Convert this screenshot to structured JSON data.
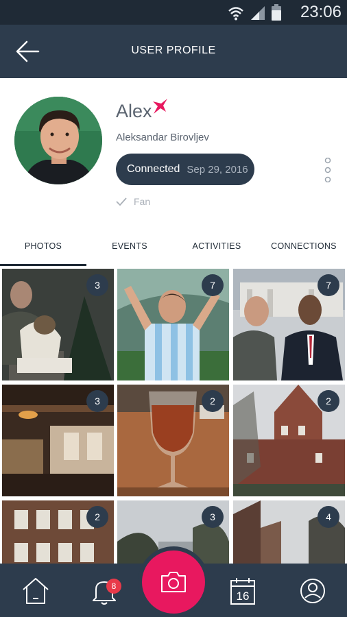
{
  "status_bar": {
    "time": "23:06",
    "icons": [
      "wifi-icon",
      "signal-icon",
      "battery-icon"
    ]
  },
  "header": {
    "title": "USER PROFILE",
    "back_icon": "arrow-left-icon"
  },
  "profile": {
    "name": "Alex",
    "full_name": "Aleksandar Birovljev",
    "connection_status": "Connected",
    "connection_date": "Sep 29, 2016",
    "relationship": "Fan",
    "accent_color": "#e8185f"
  },
  "tabs": [
    {
      "label": "PHOTOS",
      "active": true
    },
    {
      "label": "EVENTS",
      "active": false
    },
    {
      "label": "ACTIVITIES",
      "active": false
    },
    {
      "label": "CONNECTIONS",
      "active": false
    }
  ],
  "photos": [
    {
      "count": "3"
    },
    {
      "count": "7"
    },
    {
      "count": "7"
    },
    {
      "count": "3"
    },
    {
      "count": "2"
    },
    {
      "count": "2"
    },
    {
      "count": "2"
    },
    {
      "count": "3"
    },
    {
      "count": "4"
    }
  ],
  "bottom_nav": {
    "items": [
      "home-icon",
      "notifications-icon",
      "camera-icon",
      "calendar-icon",
      "profile-icon"
    ],
    "notification_count": "8",
    "calendar_day": "16"
  },
  "colors": {
    "primary": "#2d3c4d",
    "status_bar": "#1f2a36",
    "accent": "#e8185f",
    "badge": "#e83a4a"
  }
}
